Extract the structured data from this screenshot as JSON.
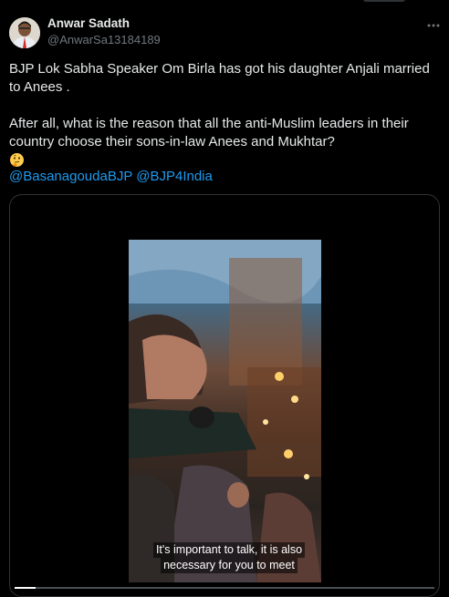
{
  "author": {
    "name": "Anwar Sadath",
    "handle": "@AnwarSa13184189"
  },
  "tweet": {
    "line1": "BJP Lok Sabha Speaker Om Birla has got his daughter Anjali married to Anees .",
    "line2": "After all, what is the reason that all the anti-Muslim leaders in their country choose their sons-in-law Anees and Mukhtar?",
    "mentions": [
      "@BasanagoudaBJP",
      "@BJP4India"
    ]
  },
  "video": {
    "caption_line1": "It's important to talk, it is also",
    "caption_line2": "necessary for you to meet",
    "progress_fraction": 0.05
  },
  "icons": {
    "more": "more-horizontal-icon",
    "emoji": "thinking-face-emoji"
  },
  "colors": {
    "background": "#000000",
    "text": "#e7e9ea",
    "secondary": "#71767b",
    "link": "#1d9bf0"
  }
}
